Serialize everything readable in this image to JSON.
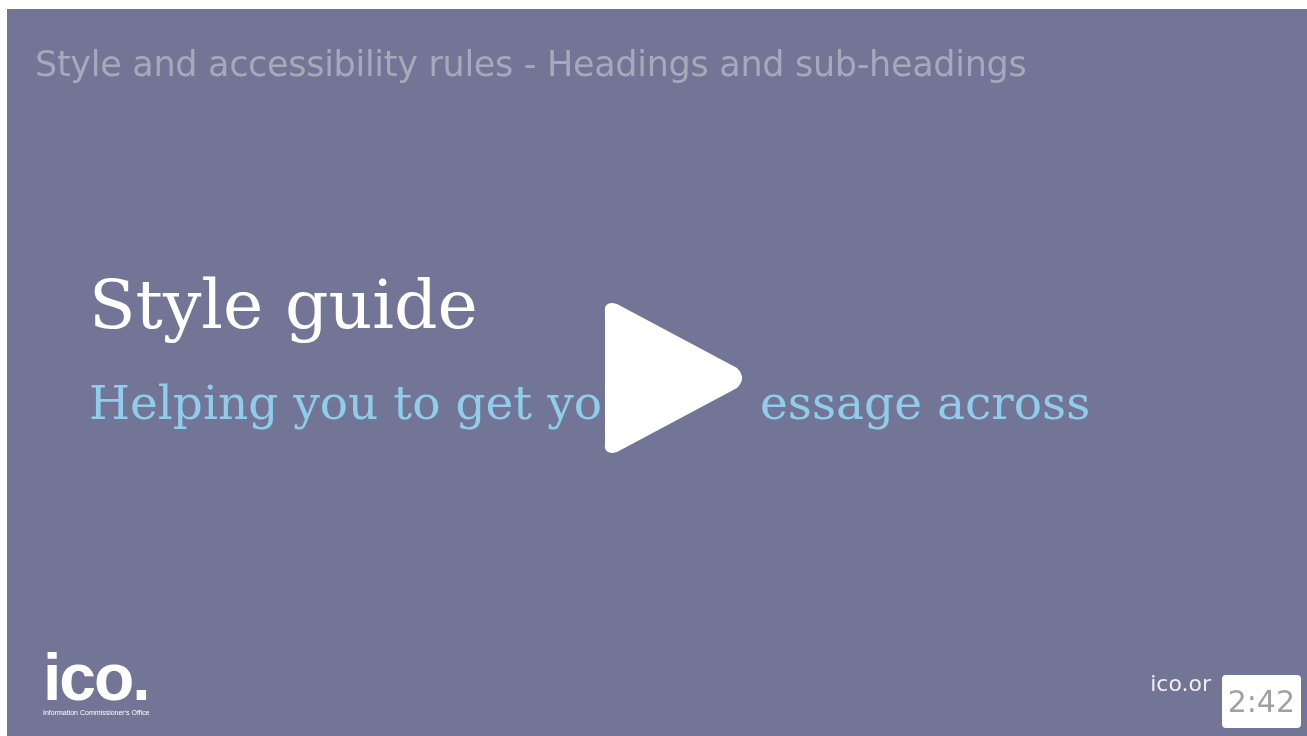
{
  "player": {
    "title": "Style and accessibility rules - Headings and sub-headings",
    "duration": "2:42"
  },
  "slide": {
    "heading": "Style guide",
    "subheading_parts": [
      "Helping you to get yo",
      "essage across"
    ],
    "logo": {
      "wordmark": "ico.",
      "tagline": "Information Commissioner's Office"
    },
    "website": "ico.or"
  }
}
